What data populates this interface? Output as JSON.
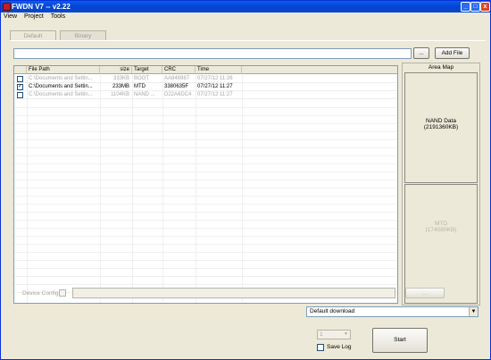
{
  "window": {
    "title": "FWDN V7 -- v2.22"
  },
  "menu": [
    "View",
    "Project",
    "Tools"
  ],
  "tabs": [
    {
      "label": "Default"
    },
    {
      "label": "Binary"
    }
  ],
  "toolbar": {
    "browse_label": "...",
    "add_file_label": "Add File"
  },
  "table": {
    "columns": [
      "File Path",
      "size",
      "Target",
      "CRC",
      "Time"
    ],
    "rows": [
      {
        "checked": false,
        "path": "C:\\Documents and Settin...",
        "size": "333KB",
        "target": "BOOT",
        "crc": "AA848987",
        "time": "07/27/12 11:26",
        "enabled": false
      },
      {
        "checked": true,
        "path": "C:\\Documents and Settin...",
        "size": "233MB",
        "target": "MTD",
        "crc": "3380635F",
        "time": "07/27/12 11:27",
        "enabled": true
      },
      {
        "checked": false,
        "path": "C:\\Documents and Settin...",
        "size": "1104KB",
        "target": "NAND ...",
        "crc": "D22A6DC4",
        "time": "07/27/12 11:27",
        "enabled": false
      }
    ]
  },
  "area_map": {
    "title": "Area Map",
    "nand_label": "NAND Data",
    "nand_size": "(2191360KB)",
    "mtd_label": "MTD",
    "mtd_size": "(174080KB)"
  },
  "device_config": {
    "label": "Device Config",
    "browse_label": "..."
  },
  "download_mode": {
    "selected": "Default download"
  },
  "bottom": {
    "spinner_value": "1",
    "save_log_label": "Save Log",
    "start_label": "Start"
  }
}
